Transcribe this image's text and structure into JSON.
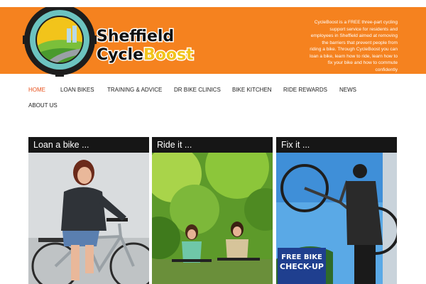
{
  "site": {
    "logo_line1": "Sheffield",
    "logo_line2a": "Cycle",
    "logo_line2b": "Boost",
    "tagline": "CycleBoost is a FREE three-part cycling support service for residents and employees in Sheffield aimed at removing the barriers that prevent people from riding a bike. Through CycleBoost you can loan a bike, learn how to ride, learn how to fix your bike and how to commute confidently"
  },
  "nav": {
    "items": [
      {
        "label": "HOME",
        "active": true
      },
      {
        "label": "LOAN BIKES"
      },
      {
        "label": "TRAINING & ADVICE"
      },
      {
        "label": "DR BIKE CLINICS"
      },
      {
        "label": "BIKE KITCHEN"
      },
      {
        "label": "RIDE REWARDS"
      },
      {
        "label": "NEWS"
      },
      {
        "label": "ABOUT US"
      }
    ]
  },
  "cards": [
    {
      "title": "Loan a bike ..."
    },
    {
      "title": "Ride it ..."
    },
    {
      "title": "Fix it ...",
      "sign_line1": "FREE BIKE",
      "sign_line2": "CHECK-UP"
    }
  ],
  "colors": {
    "brand_orange": "#f5821f",
    "active_nav": "#e8531e",
    "card_title_bg": "#161616"
  }
}
